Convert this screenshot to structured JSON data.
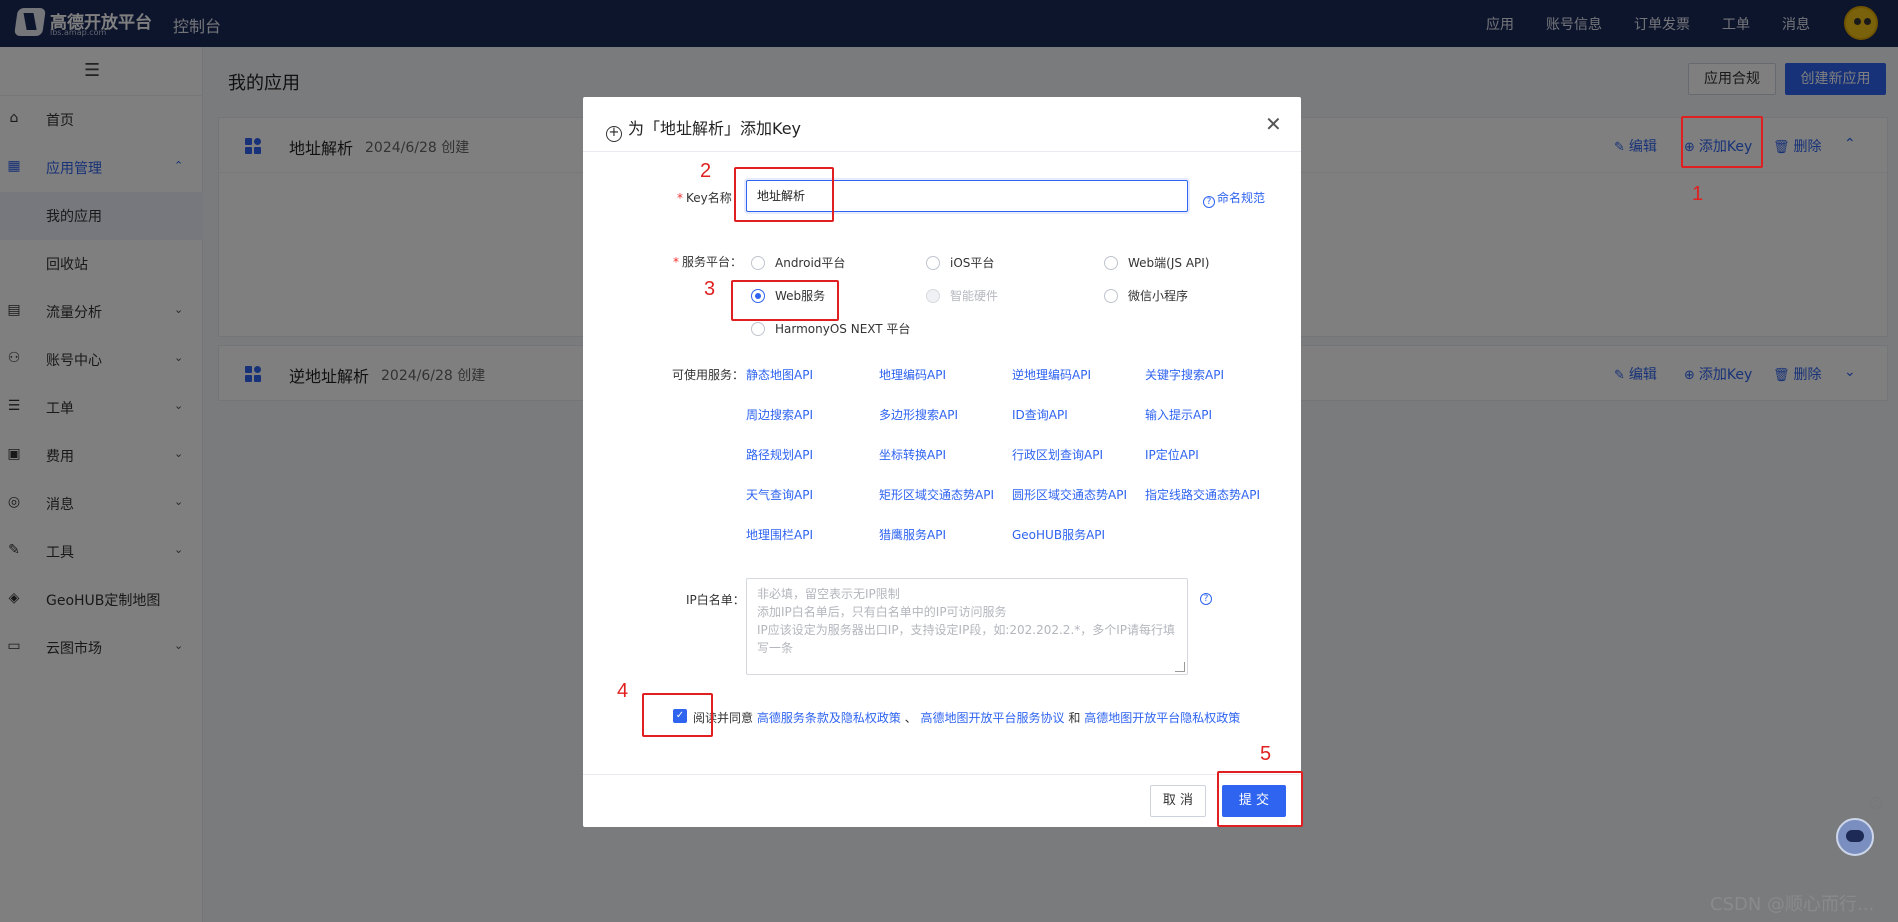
{
  "topbar": {
    "logo_text": "高德开放平台",
    "logo_sub": "lbs.amap.com",
    "console": "控制台",
    "nav": [
      "应用",
      "账号信息",
      "订单发票",
      "工单",
      "消息"
    ]
  },
  "sidebar": {
    "items": [
      {
        "label": "首页",
        "icon": "home-icon"
      },
      {
        "label": "应用管理",
        "icon": "apps-icon"
      },
      {
        "label": "我的应用"
      },
      {
        "label": "回收站"
      },
      {
        "label": "流量分析",
        "icon": "chart-icon"
      },
      {
        "label": "账号中心",
        "icon": "user-icon"
      },
      {
        "label": "工单",
        "icon": "ticket-icon"
      },
      {
        "label": "费用",
        "icon": "money-icon"
      },
      {
        "label": "消息",
        "icon": "message-icon"
      },
      {
        "label": "工具",
        "icon": "wrench-icon"
      },
      {
        "label": "GeoHUB定制地图",
        "icon": "layers-icon"
      },
      {
        "label": "云图市场",
        "icon": "store-icon"
      }
    ]
  },
  "main": {
    "title": "我的应用",
    "compliance_button": "应用合规",
    "create_button": "创建新应用",
    "apps": [
      {
        "name": "地址解析",
        "date": "2024/6/28 创建"
      },
      {
        "name": "逆地址解析",
        "date": "2024/6/28 创建"
      }
    ],
    "actions": {
      "edit": "编辑",
      "add_key": "添加Key",
      "delete": "删除"
    }
  },
  "modal": {
    "title": "为「地址解析」添加Key",
    "key_label": "Key名称",
    "key_value": "地址解析",
    "naming_rule": "命名规范",
    "platform_label": "服务平台",
    "platforms": [
      "Android平台",
      "iOS平台",
      "Web端(JS API)",
      "Web服务",
      "智能硬件",
      "微信小程序",
      "HarmonyOS NEXT 平台"
    ],
    "services_label": "可使用服务",
    "services": [
      "静态地图API",
      "地理编码API",
      "逆地理编码API",
      "关键字搜索API",
      "周边搜索API",
      "多边形搜索API",
      "ID查询API",
      "输入提示API",
      "路径规划API",
      "坐标转换API",
      "行政区划查询API",
      "IP定位API",
      "天气查询API",
      "矩形区域交通态势API",
      "圆形区域交通态势API",
      "指定线路交通态势API",
      "地理围栏API",
      "猎鹰服务API",
      "GeoHUB服务API"
    ],
    "ip_label": "IP白名单",
    "ip_placeholder_lines": [
      "非必填，留空表示无IP限制",
      "添加IP白名单后，只有白名单中的IP可访问服务",
      "IP应该设定为服务器出口IP，支持设定IP段，如:202.202.2.*，多个IP请每行填写一条"
    ],
    "agree_text": "阅读并同意",
    "agree_link1": "高德服务条款及隐私权政策",
    "agree_sep1": "、",
    "agree_link2": "高德地图开放平台服务协议",
    "agree_sep2": "和",
    "agree_link3": "高德地图开放平台隐私权政策",
    "cancel": "取 消",
    "submit": "提 交"
  },
  "annotations": [
    "1",
    "2",
    "3",
    "4",
    "5"
  ],
  "watermark": "CSDN @顺心而行...",
  "colors": {
    "accent": "#2f64f0",
    "topbar": "#1a2a5a",
    "annotation": "#e02020"
  }
}
